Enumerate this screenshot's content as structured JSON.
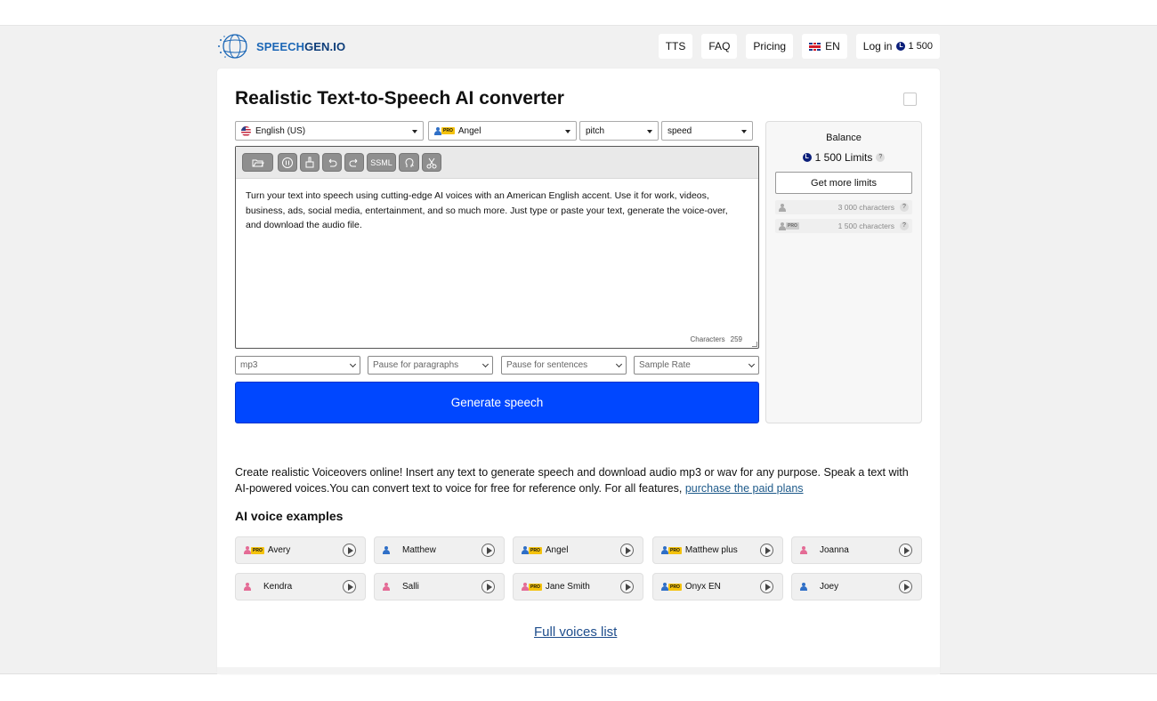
{
  "header": {
    "logo_text_a": "SPEECH",
    "logo_text_b": "GEN.IO",
    "nav": {
      "tts": "TTS",
      "faq": "FAQ",
      "pricing": "Pricing",
      "language": "EN",
      "login": "Log in",
      "login_balance": "1 500"
    }
  },
  "main": {
    "title": "Realistic Text-to-Speech AI converter",
    "language_select": "English (US)",
    "voice_select": "Angel",
    "pitch_select": "pitch",
    "speed_select": "speed",
    "toolbar": {
      "ssml": "SSML"
    },
    "editor_text": "Turn your text into speech using cutting-edge AI voices with an American English accent. Use it for work, videos, business, ads, social media, entertainment, and so much more. Just type or paste your text, generate the voice-over, and download the audio file.",
    "char_label": "Characters",
    "char_count": "259",
    "format_select": "mp3",
    "pause_paragraphs": "Pause for paragraphs",
    "pause_sentences": "Pause for sentences",
    "sample_rate": "Sample Rate",
    "generate_button": "Generate speech"
  },
  "balance": {
    "title": "Balance",
    "amount": "1 500 Limits",
    "more_button": "Get more limits",
    "standard_chars": "3 000 characters",
    "pro_chars": "1 500 characters"
  },
  "description": {
    "text": "Create realistic Voiceovers online! Insert any text to generate speech and download audio mp3 or wav for any purpose. Speak a text with AI-powered voices.You can convert text to voice for free for reference only. For all features, ",
    "link": "purchase the paid plans"
  },
  "examples": {
    "title": "AI voice examples",
    "voices": [
      {
        "name": "Avery",
        "pro": true,
        "gender": "female"
      },
      {
        "name": "Matthew",
        "pro": false,
        "gender": "male"
      },
      {
        "name": "Angel",
        "pro": true,
        "gender": "male"
      },
      {
        "name": "Matthew plus",
        "pro": true,
        "gender": "male"
      },
      {
        "name": "Joanna",
        "pro": false,
        "gender": "female"
      },
      {
        "name": "Kendra",
        "pro": false,
        "gender": "female"
      },
      {
        "name": "Salli",
        "pro": false,
        "gender": "female"
      },
      {
        "name": "Jane Smith",
        "pro": true,
        "gender": "female"
      },
      {
        "name": "Onyx EN",
        "pro": true,
        "gender": "male"
      },
      {
        "name": "Joey",
        "pro": false,
        "gender": "male"
      }
    ],
    "full_list": "Full voices list"
  },
  "badges": {
    "pro": "PRO",
    "coin": "L",
    "question": "?"
  },
  "colors": {
    "accent": "#0047ff",
    "brand": "#1c67b6",
    "male_icon": "#2f6fc7",
    "female_icon": "#e46b95"
  }
}
